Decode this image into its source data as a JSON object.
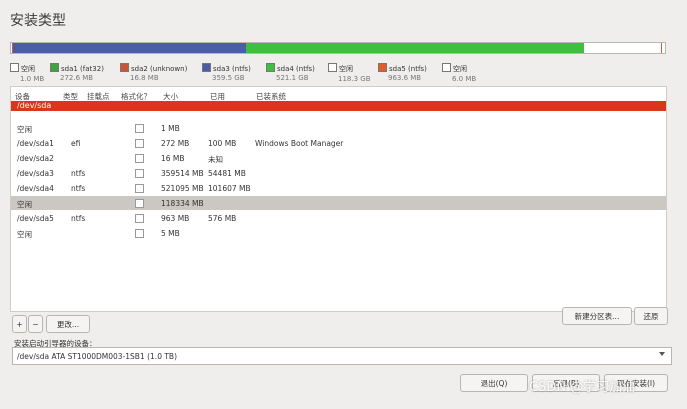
{
  "title": "安装类型",
  "bar_segments": [
    {
      "color": "#ffffff",
      "fraction": 0.001
    },
    {
      "color": "#3fa33f",
      "fraction": 0.001
    },
    {
      "color": "#c8553a",
      "fraction": 0.001
    },
    {
      "color": "#4a5ea6",
      "fraction": 0.358
    },
    {
      "color": "#3fbf3f",
      "fraction": 0.521
    },
    {
      "color": "#ffffff",
      "fraction": 0.118
    },
    {
      "color": "#e05c2a",
      "fraction": 0.001
    },
    {
      "color": "#ffffff",
      "fraction": 0.005
    }
  ],
  "legend": [
    {
      "name": "空闲",
      "size": "1.0 MB",
      "color": "#ffffff"
    },
    {
      "name": "sda1 (fat32)",
      "size": "272.6 MB",
      "color": "#3fa33f"
    },
    {
      "name": "sda2 (unknown)",
      "size": "16.8 MB",
      "color": "#c8553a"
    },
    {
      "name": "sda3 (ntfs)",
      "size": "359.5 GB",
      "color": "#4a5ea6"
    },
    {
      "name": "sda4 (ntfs)",
      "size": "521.1 GB",
      "color": "#3fbf3f"
    },
    {
      "name": "空闲",
      "size": "118.3 GB",
      "color": "#ffffff"
    },
    {
      "name": "sda5 (ntfs)",
      "size": "963.6 MB",
      "color": "#e05c2a"
    },
    {
      "name": "空闲",
      "size": "6.0 MB",
      "color": "#ffffff"
    }
  ],
  "table": {
    "headers": [
      "设备",
      "类型",
      "挂载点",
      "格式化？",
      "大小",
      "已用",
      "已装系统"
    ],
    "device": "/dev/sda",
    "rows": [
      {
        "device": "空闲",
        "type": "",
        "size": "1 MB",
        "used": "",
        "system": "",
        "selected": false
      },
      {
        "device": "/dev/sda1",
        "type": "efi",
        "size": "272 MB",
        "used": "100 MB",
        "system": "Windows Boot Manager",
        "selected": false
      },
      {
        "device": "/dev/sda2",
        "type": "",
        "size": "16 MB",
        "used": "未知",
        "system": "",
        "selected": false
      },
      {
        "device": "/dev/sda3",
        "type": "ntfs",
        "size": "359514 MB",
        "used": "54481 MB",
        "system": "",
        "selected": false
      },
      {
        "device": "/dev/sda4",
        "type": "ntfs",
        "size": "521095 MB",
        "used": "101607 MB",
        "system": "",
        "selected": false
      },
      {
        "device": "空闲",
        "type": "",
        "size": "118334 MB",
        "used": "",
        "system": "",
        "selected": true
      },
      {
        "device": "/dev/sda5",
        "type": "ntfs",
        "size": "963 MB",
        "used": "576 MB",
        "system": "",
        "selected": false
      },
      {
        "device": "空闲",
        "type": "",
        "size": "5 MB",
        "used": "",
        "system": "",
        "selected": false
      }
    ]
  },
  "buttons": {
    "add": "+",
    "remove": "−",
    "change": "更改...",
    "new_table": "新建分区表...",
    "revert": "还原",
    "quit": "退出(Q)",
    "back": "后退(B)",
    "install": "现在安装(I)"
  },
  "boot": {
    "label": "安装启动引导器的设备：",
    "value": "/dev/sda   ATA ST1000DM003-1SB1 (1.0 TB)"
  },
  "watermark": "CSDN @学习加油"
}
